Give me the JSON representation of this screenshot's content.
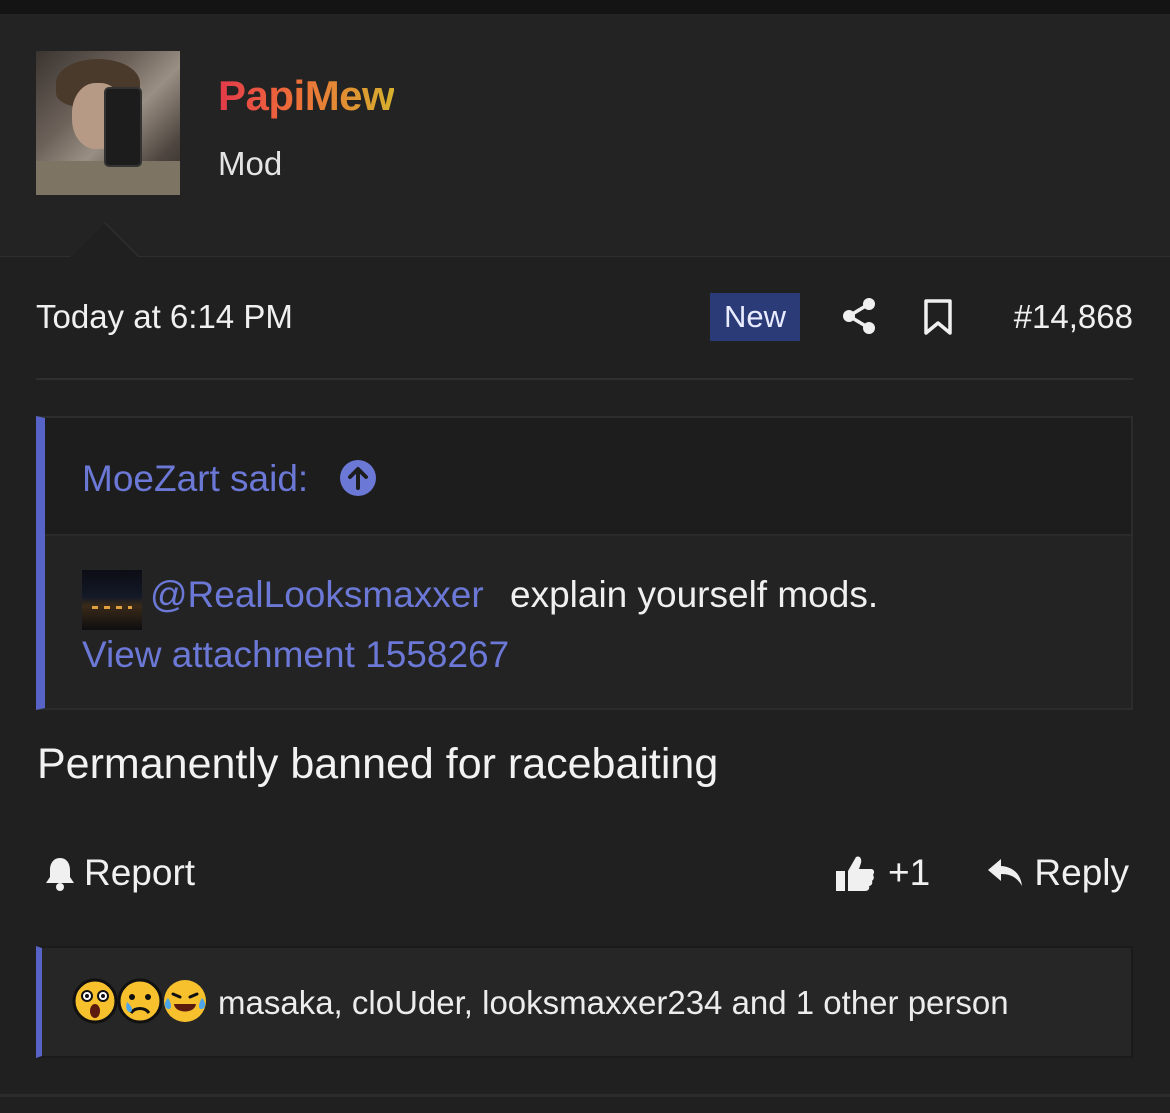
{
  "post": {
    "author": {
      "name": "PapiMew",
      "title": "Mod",
      "name_gradient": [
        "#e23a4a",
        "#ee6a3a",
        "#d6b02e"
      ]
    },
    "timestamp": "Today at 6:14 PM",
    "badge": "New",
    "number": "#14,868",
    "icons": {
      "share": "share-icon",
      "bookmark": "bookmark-icon"
    },
    "quote": {
      "author_line": "MoeZart said:",
      "mention": "@RealLooksmaxxer",
      "text": "explain yourself mods.",
      "attachment_link": "View attachment 1558267"
    },
    "message": "Permanently banned for racebaiting",
    "actions": {
      "report": "Report",
      "like": "+1",
      "reply": "Reply"
    },
    "reactions": {
      "emojis": [
        "astonished-face-icon",
        "sad-face-icon",
        "crying-laughing-face-icon"
      ],
      "users": "masaka, cloUder, looksmaxxer234 and 1 other person"
    }
  },
  "colors": {
    "background": "#202020",
    "link": "#6b78d6",
    "accent_border": "#5863c8",
    "badge_bg": "#2a3b78"
  }
}
